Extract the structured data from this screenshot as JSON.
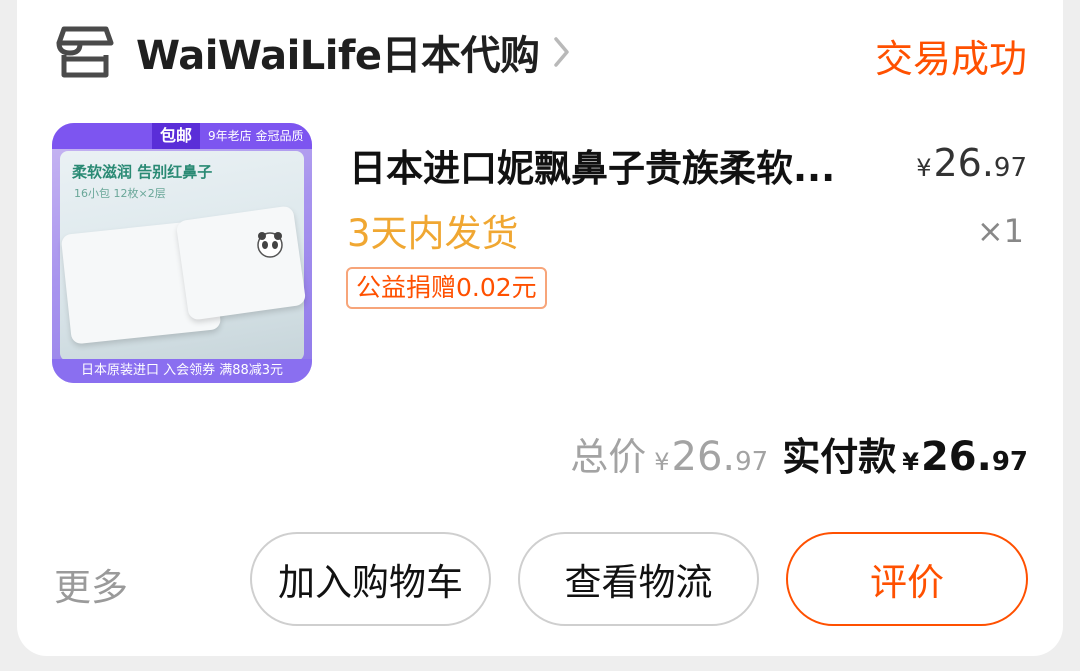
{
  "shop": {
    "name": "WaiWaiLife日本代购",
    "icon": "store-icon",
    "chevron": "chevron-right-icon"
  },
  "order": {
    "status": "交易成功"
  },
  "product": {
    "title": "日本进口妮飘鼻子贵族柔软...",
    "shipping": "3天内发货",
    "charity_tag": "公益捐赠0.02元",
    "unit_price": {
      "currency": "¥",
      "int": "26.",
      "dec": "97"
    },
    "quantity": "×1",
    "thumbnail": {
      "badge": "包邮",
      "store_tag": "9年老店 金冠品质",
      "slogan": "柔软滋润 告别红鼻子",
      "subtext": "16小包 12枚×2层",
      "bottom_banner": "日本原装进口 入会领券 满88减3元"
    }
  },
  "totals": {
    "total_label": "总价",
    "total": {
      "currency": "¥",
      "int": "26.",
      "dec": "97"
    },
    "paid_label": "实付款",
    "paid": {
      "currency": "¥",
      "int": "26.",
      "dec": "97"
    }
  },
  "actions": {
    "more": "更多",
    "add_to_cart": "加入购物车",
    "track_logistics": "查看物流",
    "review": "评价"
  },
  "colors": {
    "accent": "#ff5000",
    "shipping": "#f0a732",
    "muted": "#a3a3a3"
  }
}
